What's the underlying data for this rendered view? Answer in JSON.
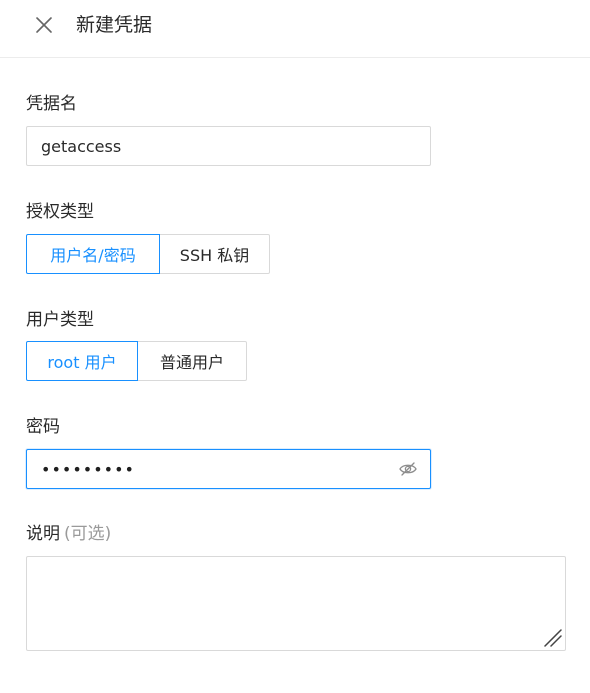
{
  "header": {
    "title": "新建凭据",
    "close_icon": "close-icon"
  },
  "form": {
    "name": {
      "label": "凭据名",
      "value": "getaccess"
    },
    "auth_type": {
      "label": "授权类型",
      "options": [
        "用户名/密码",
        "SSH 私钥"
      ],
      "selected": "用户名/密码"
    },
    "user_type": {
      "label": "用户类型",
      "options": [
        "root 用户",
        "普通用户"
      ],
      "selected": "root 用户"
    },
    "password": {
      "label": "密码",
      "masked_value": "•••••••••",
      "toggle_icon": "eye-off-icon"
    },
    "description": {
      "label": "说明",
      "optional_hint": "(可选)",
      "value": ""
    }
  },
  "colors": {
    "accent": "#1890ff",
    "border": "#d9d9d9",
    "text": "#2a2a2a",
    "muted": "#9a9a9a"
  }
}
